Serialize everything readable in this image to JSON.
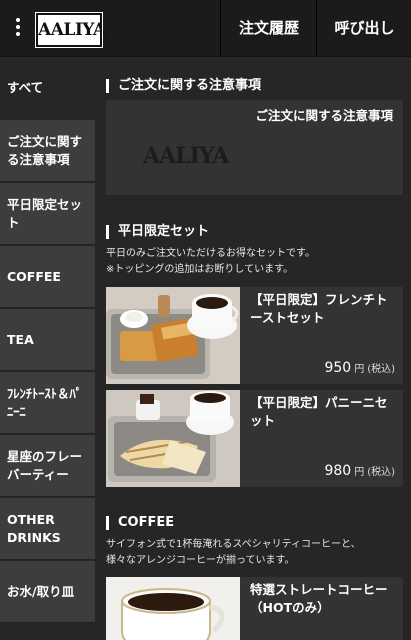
{
  "header": {
    "logo_text": "AALIYA",
    "history_label": "注文履歴",
    "call_label": "呼び出し"
  },
  "sidebar": {
    "items": [
      {
        "label": "すべて"
      },
      {
        "label": "ご注文に関する注意事項"
      },
      {
        "label": "平日限定セット"
      },
      {
        "label": "COFFEE"
      },
      {
        "label": "TEA"
      },
      {
        "label": "ﾌﾚﾝﾁﾄｰｽﾄ＆ﾊﾟﾆｰﾆ"
      },
      {
        "label": "星座のフレーバーティー"
      },
      {
        "label": "OTHER DRINKS"
      },
      {
        "label": "お水/取り皿"
      }
    ]
  },
  "sections": {
    "notice": {
      "title": "ご注文に関する注意事項",
      "card_title": "ご注文に関する注意事項",
      "card_logo": "AALIYA"
    },
    "weekday": {
      "title": "平日限定セット",
      "desc_line1": "平日のみご注文いただけるお得なセットです。",
      "desc_line2": "※トッピングの追加はお断りしています。",
      "products": [
        {
          "name": "【平日限定】フレンチトーストセット",
          "price": "950",
          "unit": "円",
          "tax": "(税込)"
        },
        {
          "name": "【平日限定】パニーニセット",
          "price": "980",
          "unit": "円",
          "tax": "(税込)"
        }
      ]
    },
    "coffee": {
      "title": "COFFEE",
      "desc_line1": "サイフォン式で1杯毎淹れるスペシャリティコーヒーと、",
      "desc_line2": "様々なアレンジコーヒーが揃っています。",
      "products": [
        {
          "name": "特選ストレートコーヒー（HOTのみ）"
        }
      ]
    }
  },
  "colors": {
    "background": "#262626",
    "header": "#1b1b1b",
    "sidebar_item": "#3d3d3d",
    "card": "#333333"
  }
}
